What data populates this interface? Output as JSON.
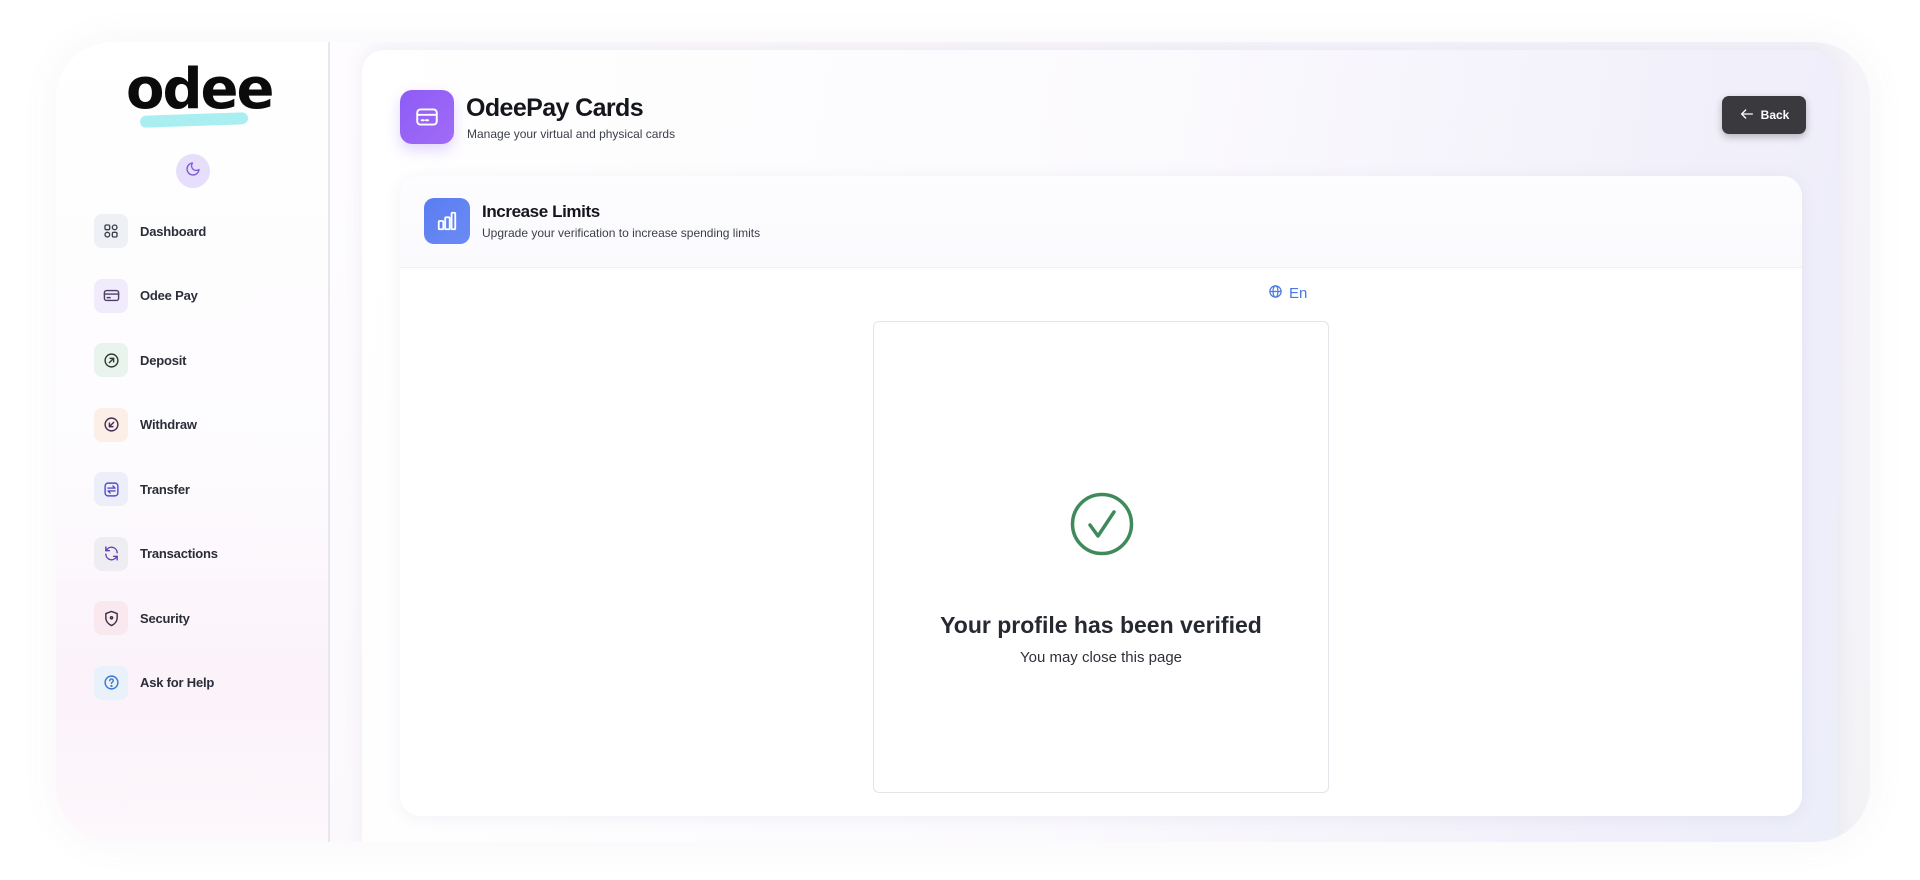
{
  "brand": {
    "name": "odee"
  },
  "sidebar": {
    "items": [
      {
        "label": "Dashboard",
        "icon": "grid-icon",
        "bg": "#eef0f5",
        "color": "#3a3f4a"
      },
      {
        "label": "Odee Pay",
        "icon": "card-icon",
        "bg": "#f1ecfb",
        "color": "#4b3f6a"
      },
      {
        "label": "Deposit",
        "icon": "arrow-up-circle-icon",
        "bg": "#eaf4ee",
        "color": "#2e3c32"
      },
      {
        "label": "Withdraw",
        "icon": "arrow-down-circle-icon",
        "bg": "#fbefe7",
        "color": "#3f2f56"
      },
      {
        "label": "Transfer",
        "icon": "transfer-icon",
        "bg": "#eceefa",
        "color": "#5a4bc9"
      },
      {
        "label": "Transactions",
        "icon": "refresh-icon",
        "bg": "#eeeef2",
        "color": "#6a3fb8"
      },
      {
        "label": "Security",
        "icon": "shield-icon",
        "bg": "#fae8ef",
        "color": "#3a2f48"
      },
      {
        "label": "Ask for Help",
        "icon": "help-circle-icon",
        "bg": "#e9f1fb",
        "color": "#3a78c9"
      }
    ]
  },
  "header": {
    "title": "OdeePay Cards",
    "subtitle": "Manage your virtual and physical cards",
    "back_label": "Back"
  },
  "card": {
    "title": "Increase Limits",
    "subtitle": "Upgrade your verification to increase spending limits"
  },
  "language": {
    "label": "En"
  },
  "verification": {
    "title": "Your profile has been verified",
    "message": "You may close this page",
    "status_color": "#3f8a5a"
  },
  "colors": {
    "accent_purple": "#8d5cf5",
    "accent_blue": "#5a7df0",
    "link_blue": "#4b78e0"
  }
}
